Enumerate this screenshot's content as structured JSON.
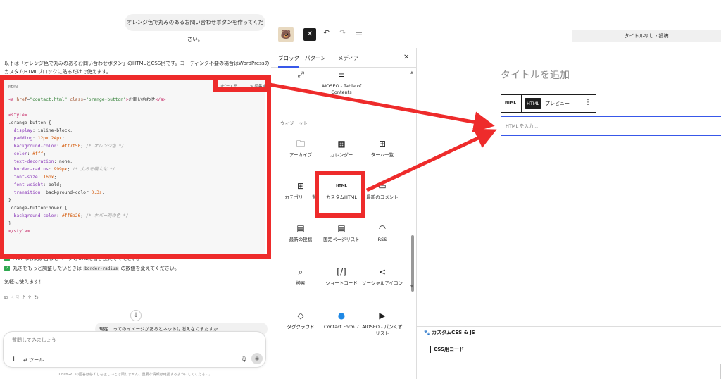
{
  "chat": {
    "user_message": "オレンジ色で丸みのあるお問い合わせボタンを作ってください。",
    "intro_text": "以下は「オレンジ色で丸みのあるお問い合わせボタン」のHTMLとCSS例です。コーディング不要の場合はWordPressのカスタムHTMLブロックに貼るだけで使えます。",
    "code_block": {
      "language": "html",
      "copy_label": "コピーする",
      "edit_label": "編集する"
    },
    "check_items": [
      "href はお問い合わせページのURLに書き換えてください。",
      "丸さをもっと調整したいときは",
      "border-radius",
      "の数値を変えてください。"
    ],
    "closing_text": "気軽に使えます！",
    "followup_message": "現在…ってのイメージがあるとネットは消えなくまたすか……",
    "composer": {
      "placeholder": "質問してみましょう",
      "tools_label": "ツール"
    },
    "disclaimer": "ChatGPT の回答は必ずしも正しいとは限りません。重要な情報は確認するようにしてください。"
  },
  "code_lines": [
    [
      [
        "c-tag",
        "<a "
      ],
      [
        "c-attr",
        "href"
      ],
      [
        "c-plain",
        "="
      ],
      [
        "c-str",
        "\"contact.html\" "
      ],
      [
        "c-attr",
        "class"
      ],
      [
        "c-plain",
        "="
      ],
      [
        "c-str",
        "\"orange-button\""
      ],
      [
        "c-tag",
        ">"
      ],
      [
        "c-plain",
        "お問い合わせ"
      ],
      [
        "c-tag",
        "</a>"
      ]
    ],
    [],
    [
      [
        "c-tag",
        "<style>"
      ]
    ],
    [
      [
        "c-plain",
        ".orange-button {"
      ]
    ],
    [
      [
        "c-prop",
        "  display"
      ],
      [
        "c-plain",
        ": inline-block;"
      ]
    ],
    [
      [
        "c-prop",
        "  padding"
      ],
      [
        "c-plain",
        ": "
      ],
      [
        "c-num",
        "12px 24px"
      ],
      [
        "c-plain",
        ";"
      ]
    ],
    [
      [
        "c-prop",
        "  background-color"
      ],
      [
        "c-plain",
        ": "
      ],
      [
        "c-num",
        "#ff7f50"
      ],
      [
        "c-plain",
        "; "
      ],
      [
        "c-cmt",
        "/* オレンジ色 */"
      ]
    ],
    [
      [
        "c-prop",
        "  color"
      ],
      [
        "c-plain",
        ": "
      ],
      [
        "c-num",
        "#fff"
      ],
      [
        "c-plain",
        ";"
      ]
    ],
    [
      [
        "c-prop",
        "  text-decoration"
      ],
      [
        "c-plain",
        ": none;"
      ]
    ],
    [
      [
        "c-prop",
        "  border-radius"
      ],
      [
        "c-plain",
        ": "
      ],
      [
        "c-num",
        "999px"
      ],
      [
        "c-plain",
        "; "
      ],
      [
        "c-cmt",
        "/* 丸みを最大化 */"
      ]
    ],
    [
      [
        "c-prop",
        "  font-size"
      ],
      [
        "c-plain",
        ": "
      ],
      [
        "c-num",
        "16px"
      ],
      [
        "c-plain",
        ";"
      ]
    ],
    [
      [
        "c-prop",
        "  font-weight"
      ],
      [
        "c-plain",
        ": bold;"
      ]
    ],
    [
      [
        "c-prop",
        "  transition"
      ],
      [
        "c-plain",
        ": background-color "
      ],
      [
        "c-num",
        "0.3s"
      ],
      [
        "c-plain",
        ";"
      ]
    ],
    [
      [
        "c-plain",
        "}"
      ]
    ],
    [
      [
        "c-plain",
        ".orange-button:hover {"
      ]
    ],
    [
      [
        "c-prop",
        "  background-color"
      ],
      [
        "c-plain",
        ": "
      ],
      [
        "c-num",
        "#ff6a26"
      ],
      [
        "c-plain",
        "; "
      ],
      [
        "c-cmt",
        "/* ホバー時の色 */"
      ]
    ],
    [
      [
        "c-plain",
        "}"
      ]
    ],
    [
      [
        "c-tag",
        "</style>"
      ]
    ]
  ],
  "editor": {
    "doc_title": "タイトルなし・投稿",
    "tabs": [
      "ブロック",
      "パターン",
      "メディア"
    ],
    "top_blocks": [
      "",
      "AIOSEO - Table of Contents"
    ],
    "section_widgets": "ウィジェット",
    "blocks": [
      {
        "label": "アーカイブ",
        "icon": "archive-icon",
        "glyph": "🗀"
      },
      {
        "label": "カレンダー",
        "icon": "calendar-icon",
        "glyph": "▦"
      },
      {
        "label": "ターム一覧",
        "icon": "grid-icon",
        "glyph": "⊞"
      },
      {
        "label": "カテゴリー一覧",
        "icon": "categories-icon",
        "glyph": "⊞"
      },
      {
        "label": "カスタムHTML",
        "icon": "html-icon",
        "glyph": "HTML"
      },
      {
        "label": "最新のコメント",
        "icon": "comment-icon",
        "glyph": "▭"
      },
      {
        "label": "最新の投稿",
        "icon": "list-icon",
        "glyph": "▤"
      },
      {
        "label": "固定ページリスト",
        "icon": "page-list-icon",
        "glyph": "▤"
      },
      {
        "label": "RSS",
        "icon": "rss-icon",
        "glyph": "◠"
      },
      {
        "label": "検索",
        "icon": "search-icon",
        "glyph": "⌕"
      },
      {
        "label": "ショートコード",
        "icon": "shortcode-icon",
        "glyph": "[/]"
      },
      {
        "label": "ソーシャルアイコン",
        "icon": "share-icon",
        "glyph": "<"
      },
      {
        "label": "タグクラウド",
        "icon": "tag-icon",
        "glyph": "◇"
      },
      {
        "label": "Contact Form 7",
        "icon": "contact-form-icon",
        "glyph": "●"
      },
      {
        "label": "AIOSEO - パンくずリスト",
        "icon": "breadcrumb-icon",
        "glyph": "▶"
      }
    ],
    "post_title_placeholder": "タイトルを追加",
    "block_toolbar": {
      "html_label": "HTML",
      "preview_label": "プレビュー"
    },
    "html_input_placeholder": "HTML を入力…",
    "meta_title": "カスタムCSS & JS",
    "meta_sub": "CSS用コード"
  },
  "colors": {
    "annotation": "#ee2b2b",
    "accent": "#3858e9"
  }
}
